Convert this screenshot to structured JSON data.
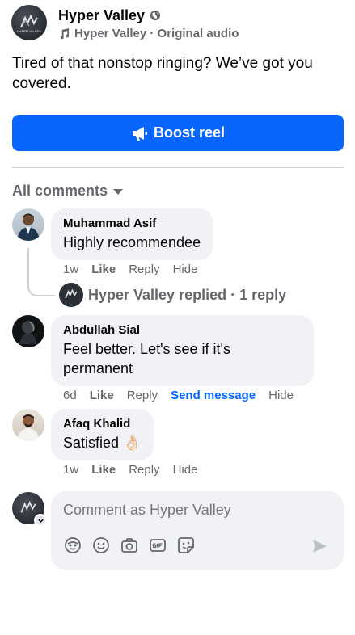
{
  "post": {
    "page_name": "Hyper Valley",
    "audio_label": "Hyper Valley · Original audio",
    "caption": "Tired of that nonstop ringing? We’ve got you covered.",
    "boost_label": "Boost reel",
    "logo_text": "HYPER VALLEY"
  },
  "comments_filter": "All comments",
  "comments": [
    {
      "author": "Muhammad Asif",
      "text": "Highly recommendee",
      "time": "1w",
      "like": "Like",
      "reply": "Reply",
      "hide": "Hide"
    },
    {
      "author": "Abdullah Sial",
      "text": "Feel better. Let's see if it's permanent",
      "time": "6d",
      "like": "Like",
      "reply": "Reply",
      "send_message": "Send message",
      "hide": "Hide"
    },
    {
      "author": "Afaq Khalid",
      "text": "Satisfied 👌🏻",
      "time": "1w",
      "like": "Like",
      "reply": "Reply",
      "hide": "Hide"
    }
  ],
  "thread_reply": "Hyper Valley replied · 1 reply",
  "composer": {
    "placeholder": "Comment as Hyper Valley",
    "icons": [
      "avatar-sticker-icon",
      "emoji-icon",
      "camera-icon",
      "gif-icon",
      "sticker-icon"
    ],
    "send_icon": "send-icon"
  },
  "colors": {
    "accent": "#0866ff",
    "bubble": "#f0f2f5",
    "secondary_text": "#65676b"
  }
}
